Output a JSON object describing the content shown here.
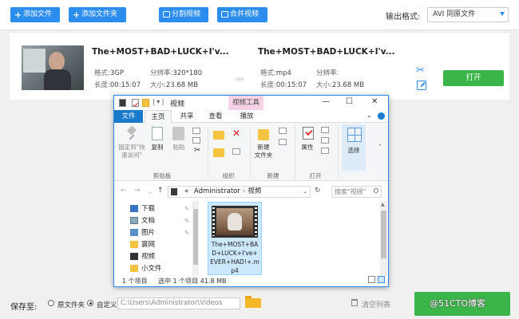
{
  "toolbar": {
    "add_file": "添加文件",
    "add_folder": "添加文件夹",
    "split_video": "分割视频",
    "merge_video": "合并视频",
    "output_format_label": "输出格式:",
    "output_format_value": "AVI  同原文件"
  },
  "source": {
    "title": "The+MOST+BAD+LUCK+I'v...",
    "format_key": "格式:",
    "format": "3GP",
    "resolution_key": "分辨率:",
    "resolution": "320*180",
    "duration_key": "长度:",
    "duration": "00:15:07",
    "size_key": "大小:",
    "size": "23.68 MB"
  },
  "output": {
    "title": "The+MOST+BAD+LUCK+I'v...",
    "format_key": "格式:",
    "format": "mp4",
    "resolution_key": "分辨率:",
    "resolution": "",
    "duration_key": "长度:",
    "duration": "00:15:07",
    "size_key": "大小:",
    "size": "23.68 MB"
  },
  "row_actions": {
    "play_label": "打开",
    "arrows": "›››››"
  },
  "bottom": {
    "save_to_label": "保存至:",
    "opt_source": "原文件夹",
    "opt_custom": "自定义",
    "save_path": "C:\\Users\\Administrator\\Videos",
    "clear_list": "清空列表",
    "watermark": "@51CTO博客"
  },
  "explorer": {
    "title": "视频",
    "qa_sep": "| ▾ |",
    "context_tab": "视频工具",
    "tabs": {
      "file": "文件",
      "home": "主页",
      "share": "共享",
      "view": "查看",
      "play": "播放"
    },
    "ribbon": {
      "pin": "固定到\"快\n速访问\"",
      "copy": "复制",
      "paste": "粘贴",
      "clipboard_group": "剪贴板",
      "organize_group": "组织",
      "new_folder": "新建\n文件夹",
      "new_group": "新建",
      "properties": "属性",
      "open_group": "打开",
      "select": "选择"
    },
    "address": {
      "root": "Administrator",
      "folder": "视频",
      "lead": "«"
    },
    "search_placeholder": "搜索\"视频\"",
    "nav_items": [
      {
        "label": "下载"
      },
      {
        "label": "文档"
      },
      {
        "label": "图片"
      },
      {
        "label": "寰网"
      },
      {
        "label": "视频"
      },
      {
        "label": "小文件"
      }
    ],
    "file": {
      "name": "The+MOST+BAD+LUCK+I've+EVER+HAD!+.mp4"
    },
    "status": {
      "count": "1 个项目",
      "selected": "选中 1 个项目  41.8 MB"
    }
  }
}
